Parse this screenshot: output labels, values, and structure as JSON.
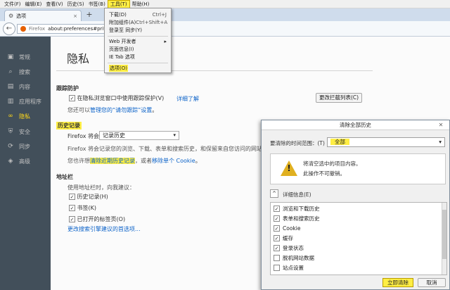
{
  "menubar": {
    "items": [
      {
        "label": "文件(F)"
      },
      {
        "label": "编辑(E)"
      },
      {
        "label": "查看(V)"
      },
      {
        "label": "历史(S)"
      },
      {
        "label": "书签(B)"
      },
      {
        "label": "工具(T)"
      },
      {
        "label": "帮助(H)"
      }
    ]
  },
  "tab": {
    "title": "选项",
    "close": "×"
  },
  "newtab": "+",
  "address": {
    "brand": "Firefox",
    "url": "about:preferences#privacy"
  },
  "tools_menu": {
    "items": [
      {
        "label": "下载(D)",
        "shortcut": "Ctrl+J"
      },
      {
        "label": "附加组件(A)",
        "shortcut": "Ctrl+Shift+A"
      },
      {
        "label": "登录至 同步(Y)",
        "shortcut": ""
      },
      {
        "label": "Web 开发者",
        "shortcut": "▸"
      },
      {
        "label": "页面信息(I)",
        "shortcut": ""
      },
      {
        "label": "IE Tab 选项",
        "shortcut": ""
      },
      {
        "label": "选项(O)",
        "shortcut": ""
      }
    ]
  },
  "sidebar": {
    "items": [
      {
        "label": "常规",
        "icon": "▣"
      },
      {
        "label": "搜索",
        "icon": "⌕"
      },
      {
        "label": "内容",
        "icon": "▤"
      },
      {
        "label": "应用程序",
        "icon": "▥"
      },
      {
        "label": "隐私",
        "icon": "∞"
      },
      {
        "label": "安全",
        "icon": "⛨"
      },
      {
        "label": "同步",
        "icon": "⟳"
      },
      {
        "label": "高级",
        "icon": "◈"
      }
    ]
  },
  "page": {
    "title": "隐私",
    "tracking": {
      "heading": "跟踪防护",
      "checkbox_label": "在隐私浏览窗口中使用跟踪保护(V)",
      "learn_more": "详细了解",
      "block_list_button": "更改拦截列表(C)",
      "manage_prefix": "您还可以",
      "manage_link": "管理您的“请勿跟踪”设置",
      "manage_suffix": "。"
    },
    "history": {
      "heading": "历史记录",
      "will_label": "Firefox 将会：(W)",
      "will_value": "记录历史",
      "description": "Firefox 将会记录您的浏览、下载、表单和搜索历史，和保留来自您访问的网站的 Cookie。",
      "clear_prefix": "您也许想",
      "clear_link": "清除近期历史记录",
      "clear_mid": "，或者",
      "remove_cookies_link": "移除单个 Cookie",
      "clear_suffix": "。"
    },
    "urlbar": {
      "heading": "地址栏",
      "intro": "使用地址栏时，向我建议：",
      "options": [
        {
          "label": "历史记录(H)",
          "checked": true
        },
        {
          "label": "书签(K)",
          "checked": true
        },
        {
          "label": "已打开的标签页(O)",
          "checked": true
        }
      ],
      "search_pref_link": "更改搜索引擎建议的首选项..."
    }
  },
  "dialog": {
    "title": "清除全部历史",
    "close": "✕",
    "range_label": "要清除的时间范围：(T)",
    "range_value": "全部",
    "warning_line1": "将清空选中的项目内容。",
    "warning_line2": "此操作不可撤销。",
    "details_toggle": "^",
    "details_label": "详细信息(E)",
    "items": [
      {
        "label": "浏览和下载历史",
        "checked": true
      },
      {
        "label": "表单和搜索历史",
        "checked": true
      },
      {
        "label": "Cookie",
        "checked": true
      },
      {
        "label": "缓存",
        "checked": true
      },
      {
        "label": "登录状态",
        "checked": true
      },
      {
        "label": "脱机网站数据",
        "checked": false
      },
      {
        "label": "站点设置",
        "checked": false
      }
    ],
    "clear_button": "立即清除",
    "cancel_button": "取消"
  },
  "colors": {
    "highlight": "#ffee44",
    "sidebar_bg": "#424f5a",
    "link": "#0b62c8"
  }
}
